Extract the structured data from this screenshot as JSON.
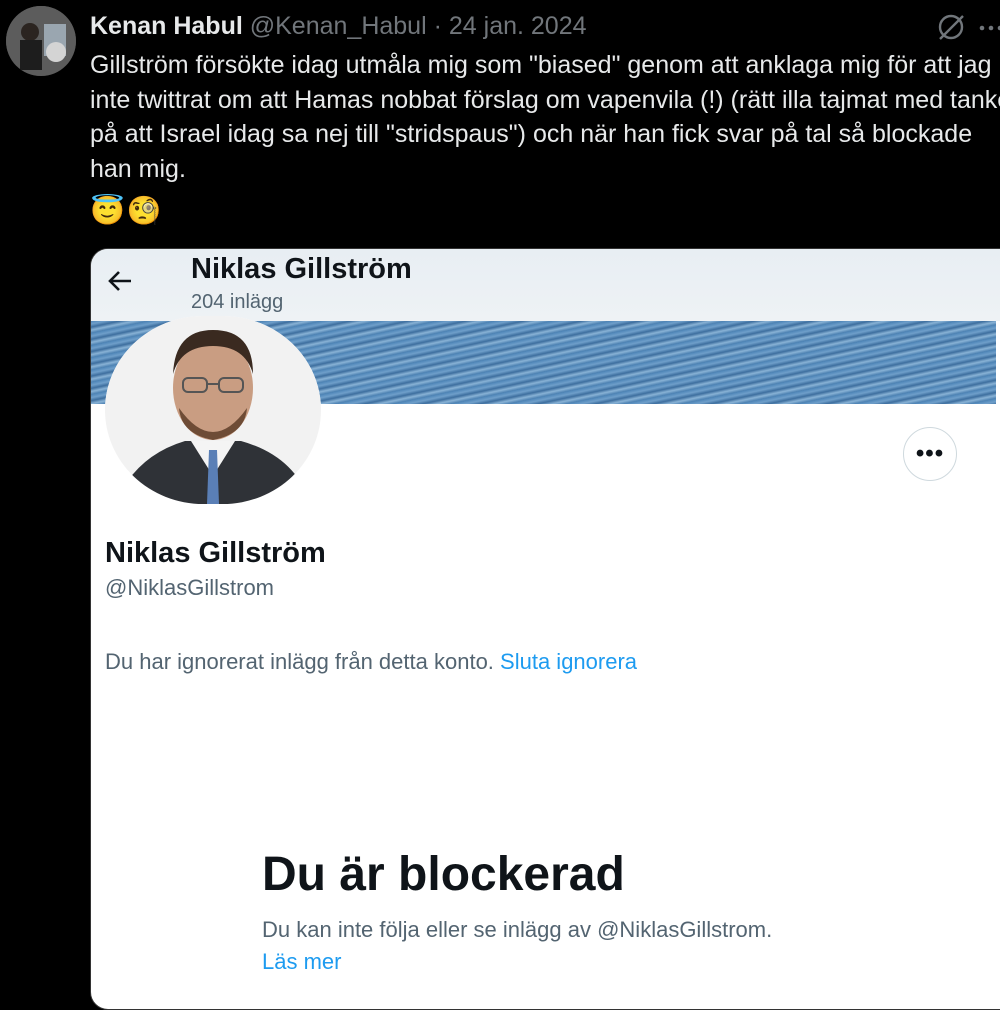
{
  "tweet": {
    "author_name": "Kenan Habul",
    "author_handle": "@Kenan_Habul",
    "separator": "·",
    "date": "24 jan. 2024",
    "text": "Gillström försökte idag utmåla mig som \"biased\" genom   att anklaga mig för att jag inte twittrat om att Hamas nobbat förslag om vapenvila (!) (rätt illa tajmat med tanke på att Israel idag sa nej till \"stridspaus\") och när han fick svar på tal så blockade han mig.",
    "emojis": [
      "😇",
      "🧐"
    ]
  },
  "profile_card": {
    "title": "Niklas Gillström",
    "post_count": "204 inlägg",
    "display_name": "Niklas Gillström",
    "handle": "@NiklasGillstrom",
    "ignored_text": "Du har ignorerat inlägg från detta konto.",
    "unignore_label": "Sluta ignorera",
    "options_label": "•••",
    "blocked_title": "Du är blockerad",
    "blocked_desc": "Du kan inte följa eller se inlägg av @NiklasGillstrom.",
    "read_more_label": "Läs mer"
  },
  "icons": {
    "grok": "grok-icon",
    "more": "more-icon",
    "back": "back-arrow-icon"
  },
  "colors": {
    "background": "#000000",
    "text_primary": "#e7e9ea",
    "text_secondary": "#71767b",
    "link": "#1d9bf0"
  }
}
